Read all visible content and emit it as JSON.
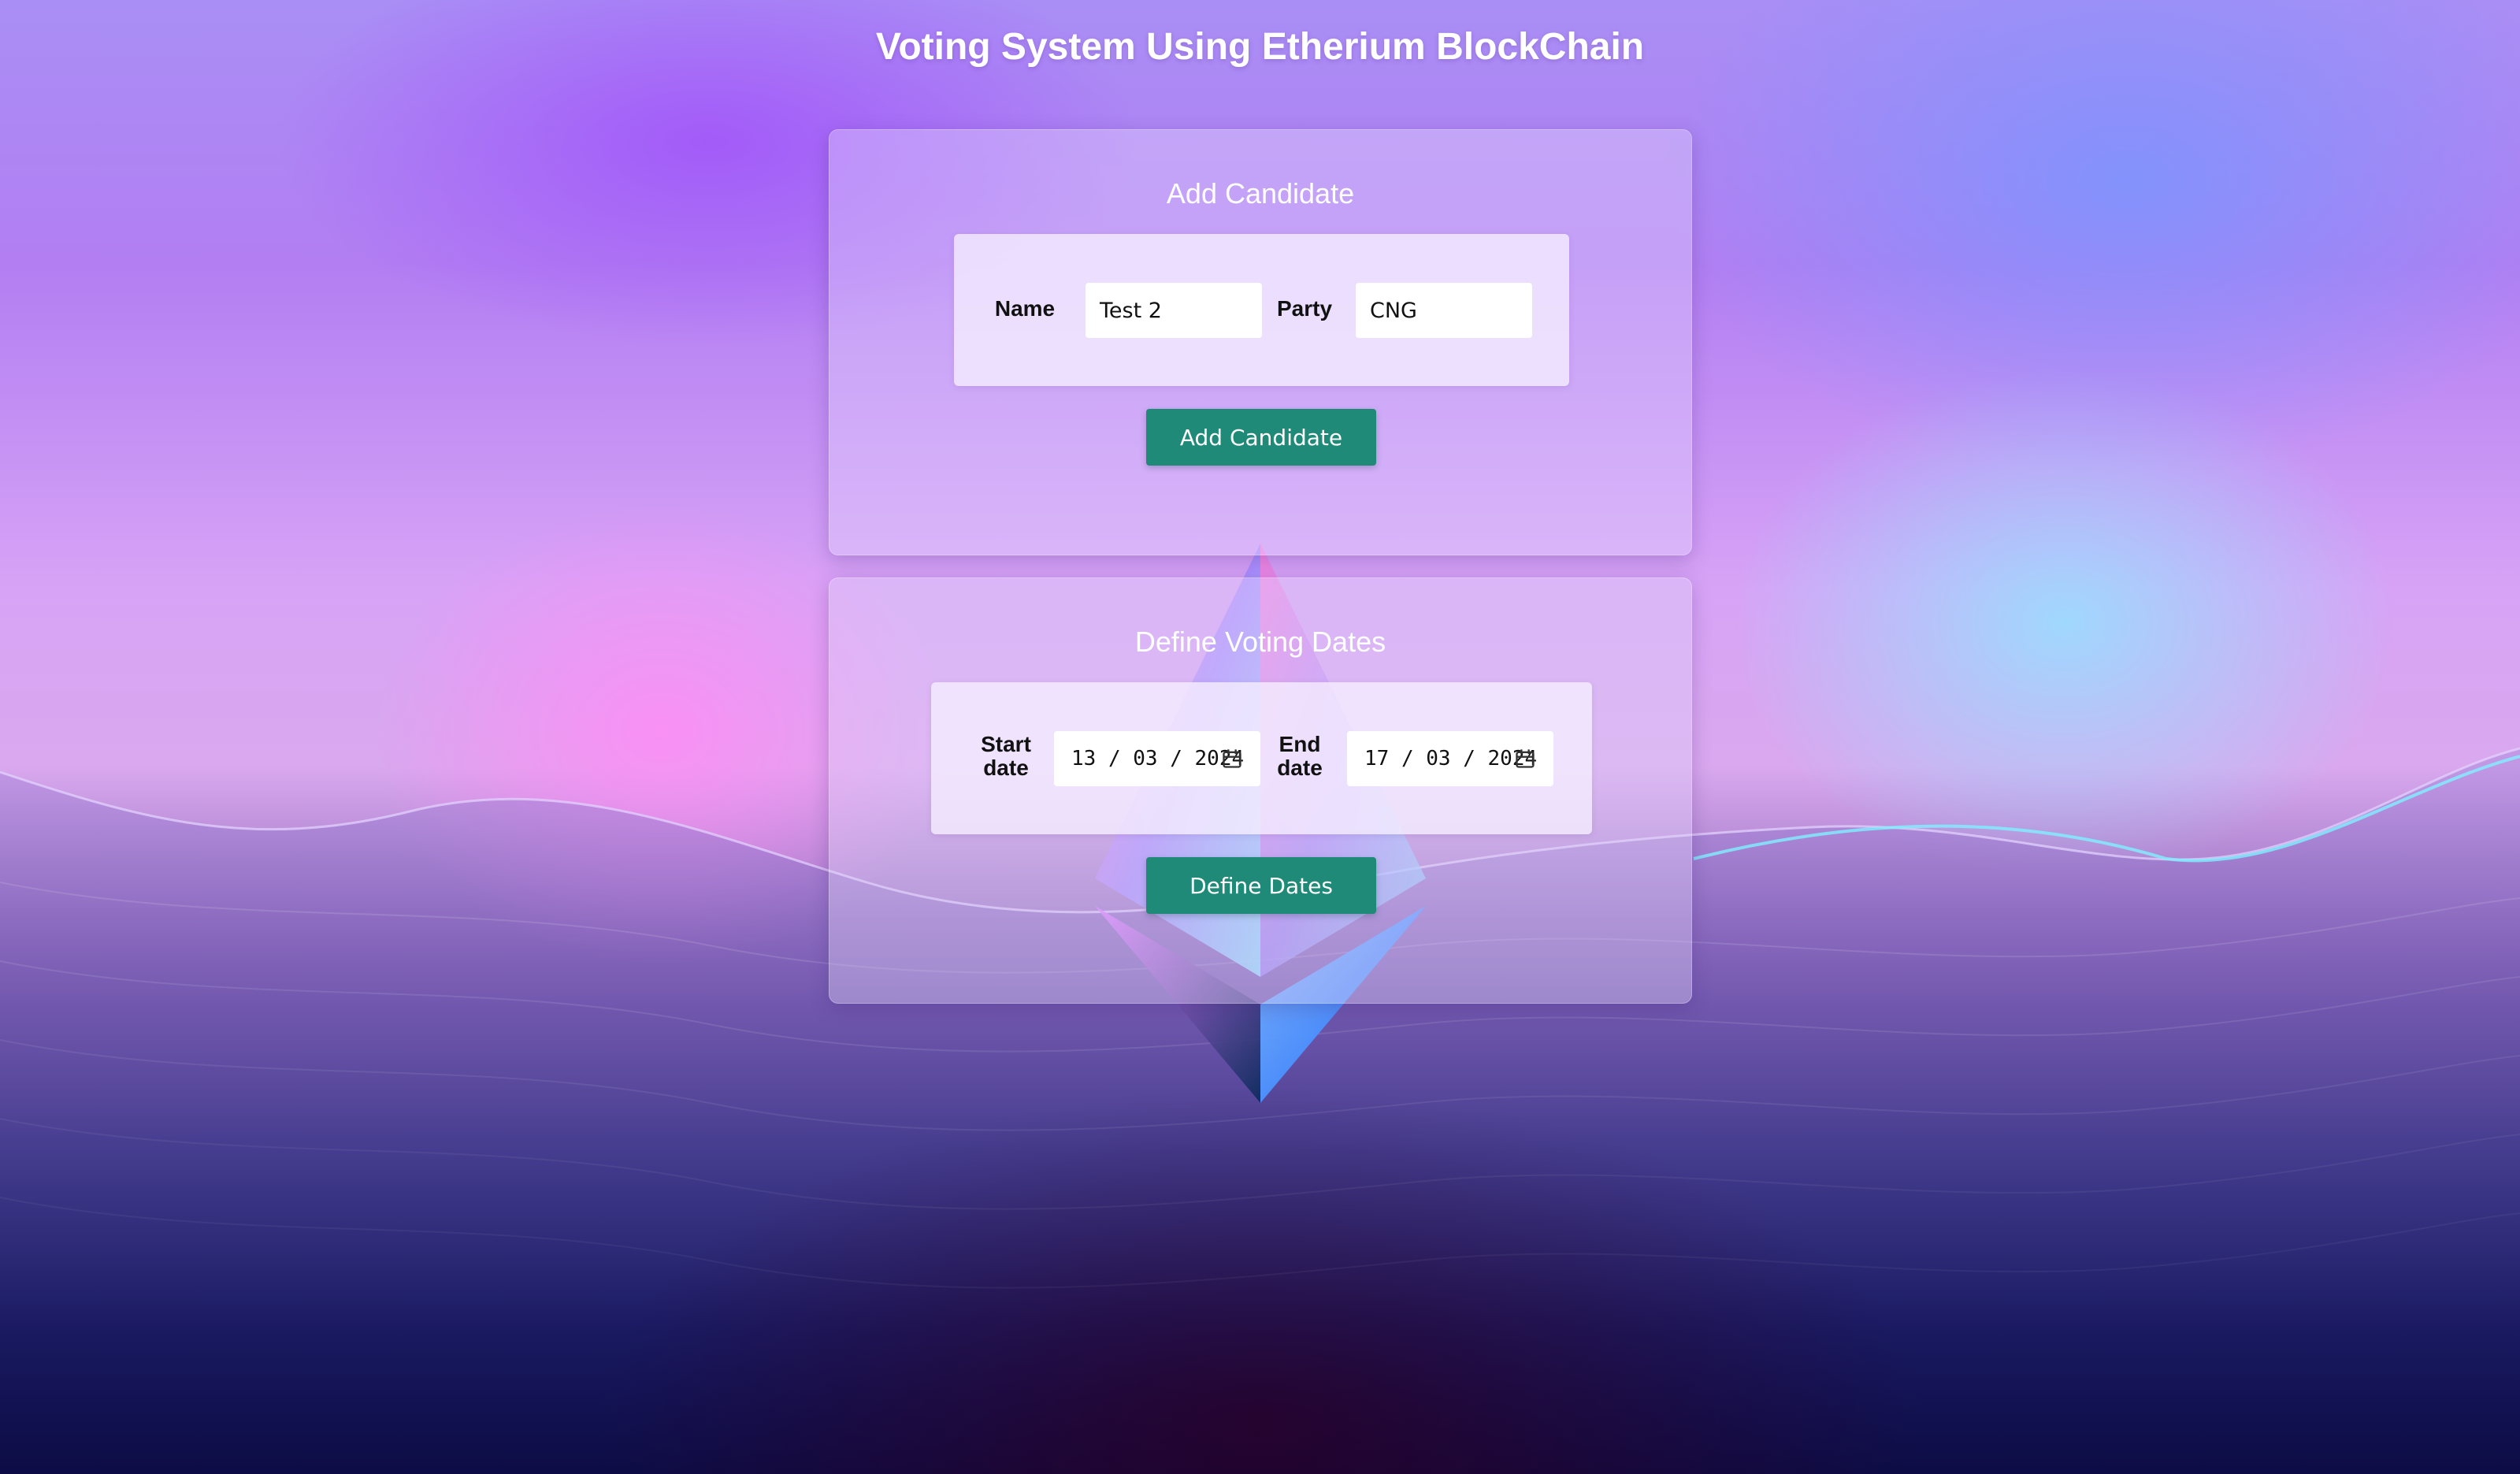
{
  "page": {
    "title": "Voting System Using Etherium BlockChain"
  },
  "add_candidate": {
    "title": "Add Candidate",
    "name_label": "Name",
    "name_value": "Test 2",
    "party_label": "Party",
    "party_value": "CNG",
    "button_label": "Add Candidate"
  },
  "voting_dates": {
    "title": "Define Voting Dates",
    "start_label_line1": "Start",
    "start_label_line2": "date",
    "start_value": "13 / 03 / 2024",
    "end_label_line1": "End",
    "end_label_line2": "date",
    "end_value": "17 / 03 / 2024",
    "button_label": "Define Dates"
  },
  "colors": {
    "button": "#1f8a78",
    "title_text": "#ffffff"
  },
  "icons": {
    "background_logo": "ethereum-logo-icon",
    "date_picker": "calendar-icon"
  }
}
